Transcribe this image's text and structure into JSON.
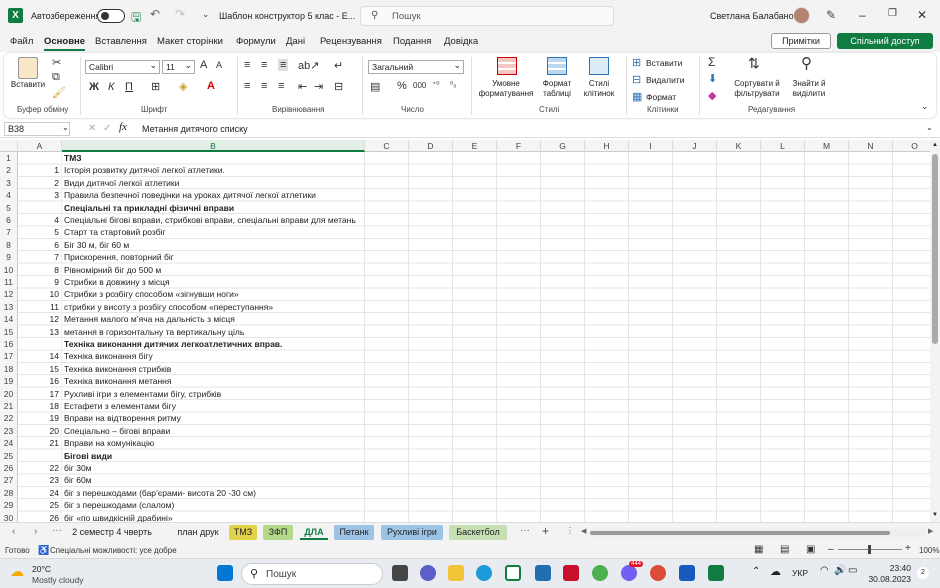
{
  "titlebar": {
    "autosave_label": "Автозбереження",
    "doc_title": "Шаблон конструктор 5 клас  - Е...",
    "search_placeholder": "Пошук",
    "user_name": "Светлана Балабанова"
  },
  "menu": {
    "items": [
      "Файл",
      "Основне",
      "Вставлення",
      "Макет сторінки",
      "Формули",
      "Дані",
      "Рецензування",
      "Подання",
      "Довідка"
    ],
    "active": "Основне",
    "notes_label": "Примітки",
    "share_label": "Спільний доступ"
  },
  "ribbon": {
    "clipboard": {
      "paste_label": "Вставити",
      "group_label": "Буфер обміну"
    },
    "font": {
      "font_name": "Calibri",
      "font_size": "11",
      "group_label": "Шрифт"
    },
    "alignment": {
      "group_label": "Вирівнювання"
    },
    "number": {
      "format": "Загальний",
      "group_label": "Число"
    },
    "styles": {
      "conditional_label_1": "Умовне",
      "conditional_label_2": "форматування",
      "format_table_1": "Формат",
      "format_table_2": "таблиці",
      "cell_styles_1": "Стилі",
      "cell_styles_2": "клітинок",
      "group_label": "Стилі"
    },
    "cells": {
      "insert_label": "Вставити",
      "delete_label": "Видалити",
      "format_label": "Формат",
      "group_label": "Клітинки"
    },
    "editing": {
      "sort_1": "Сортувати й",
      "sort_2": "фільтрувати",
      "find_1": "Знайти й",
      "find_2": "виділити",
      "group_label": "Редагування"
    }
  },
  "formula_bar": {
    "name_box": "B38",
    "fx": "fx",
    "formula": "Метання дитячого списку"
  },
  "columns": [
    "A",
    "B",
    "C",
    "D",
    "E",
    "F",
    "G",
    "H",
    "I",
    "J",
    "K",
    "L",
    "M",
    "N",
    "O"
  ],
  "rows": [
    {
      "n": "1",
      "a": "",
      "b": "ТМЗ",
      "bold": true
    },
    {
      "n": "2",
      "a": "1",
      "b": "Історія розвитку дитячої легкої атлетики.",
      "bold": false
    },
    {
      "n": "3",
      "a": "2",
      "b": "Види дитячої легкої атлетики",
      "bold": false
    },
    {
      "n": "4",
      "a": "3",
      "b": "Правила безпечної поведінки на уроках дитячої легкої атлетики",
      "bold": false
    },
    {
      "n": "5",
      "a": "",
      "b": "Спеціальні та прикладні фізичні вправи",
      "bold": true
    },
    {
      "n": "6",
      "a": "4",
      "b": "Спеціальні бігові вправи, стрибкові вправи, спеціальні вправи для метань",
      "bold": false
    },
    {
      "n": "7",
      "a": "5",
      "b": "Старт та стартовий розбіг",
      "bold": false
    },
    {
      "n": "8",
      "a": "6",
      "b": "Біг 30 м, біг 60 м",
      "bold": false
    },
    {
      "n": "9",
      "a": "7",
      "b": "Прискорення, повторний біг",
      "bold": false
    },
    {
      "n": "10",
      "a": "8",
      "b": "Рівномірний біг до 500 м",
      "bold": false
    },
    {
      "n": "11",
      "a": "9",
      "b": "Стрибки в довжину з місця",
      "bold": false
    },
    {
      "n": "12",
      "a": "10",
      "b": "Стрибки з розбігу способом «зігнувши ноги»",
      "bold": false
    },
    {
      "n": "13",
      "a": "11",
      "b": "стрибки у висоту з розбігу способом «переступання»",
      "bold": false
    },
    {
      "n": "14",
      "a": "12",
      "b": "Метання малого м’яча на дальність з місця",
      "bold": false
    },
    {
      "n": "15",
      "a": "13",
      "b": "метання в горизонтальну та вертикальну ціль",
      "bold": false
    },
    {
      "n": "16",
      "a": "",
      "b": "Техніка виконання дитячих легкоатлетичних вправ.",
      "bold": true
    },
    {
      "n": "17",
      "a": "14",
      "b": "Техніка виконання бігу",
      "bold": false
    },
    {
      "n": "18",
      "a": "15",
      "b": "Техніка виконання стрибків",
      "bold": false
    },
    {
      "n": "19",
      "a": "16",
      "b": "Техніка виконання метання",
      "bold": false
    },
    {
      "n": "20",
      "a": "17",
      "b": "Рухливі ігри з елементами бігу, стрибків",
      "bold": false
    },
    {
      "n": "21",
      "a": "18",
      "b": "Естафети з елементами бігу",
      "bold": false
    },
    {
      "n": "22",
      "a": "19",
      "b": "Вправи на відтворення ритму",
      "bold": false
    },
    {
      "n": "23",
      "a": "20",
      "b": "Спеціально – бігові вправи",
      "bold": false
    },
    {
      "n": "24",
      "a": "21",
      "b": "Вправи на комунікацію",
      "bold": false
    },
    {
      "n": "25",
      "a": "",
      "b": "Бігові види",
      "bold": true
    },
    {
      "n": "26",
      "a": "22",
      "b": "біг 30м",
      "bold": false
    },
    {
      "n": "27",
      "a": "23",
      "b": "біг 60м",
      "bold": false
    },
    {
      "n": "28",
      "a": "24",
      "b": "біг з перешкодами (бар’єрами- висота 20 -30 см)",
      "bold": false
    },
    {
      "n": "29",
      "a": "25",
      "b": "біг з перешкодами (слалом)",
      "bold": false
    },
    {
      "n": "30",
      "a": "26",
      "b": "біг «по швидкісній драбині»",
      "bold": false
    }
  ],
  "tabs": {
    "items": [
      {
        "label": "2 семестр 4 чверть",
        "color": ""
      },
      {
        "label": "план друк",
        "color": ""
      },
      {
        "label": "ТМЗ",
        "color": "#e2d24a"
      },
      {
        "label": "ЗФП",
        "color": "#b5d98a"
      },
      {
        "label": "ДЛА",
        "color": ""
      },
      {
        "label": "Петанк",
        "color": "#9dc3e6"
      },
      {
        "label": "Рухливі ігри",
        "color": "#9dc3e6"
      },
      {
        "label": "Баскетбол",
        "color": "#c6e0b4"
      }
    ],
    "active": "ДЛА"
  },
  "status": {
    "ready": "Готово",
    "accessibility": "Спеціальні можливості: усе добре",
    "zoom": "100%"
  },
  "taskbar": {
    "temp": "20°C",
    "weather": "Mostly cloudy",
    "search": "Пошук",
    "lang": "УКР",
    "time": "23:40",
    "date": "30.08.2023",
    "badge": "444",
    "notif": "2"
  },
  "colors": {
    "excel_green": "#107c41"
  }
}
